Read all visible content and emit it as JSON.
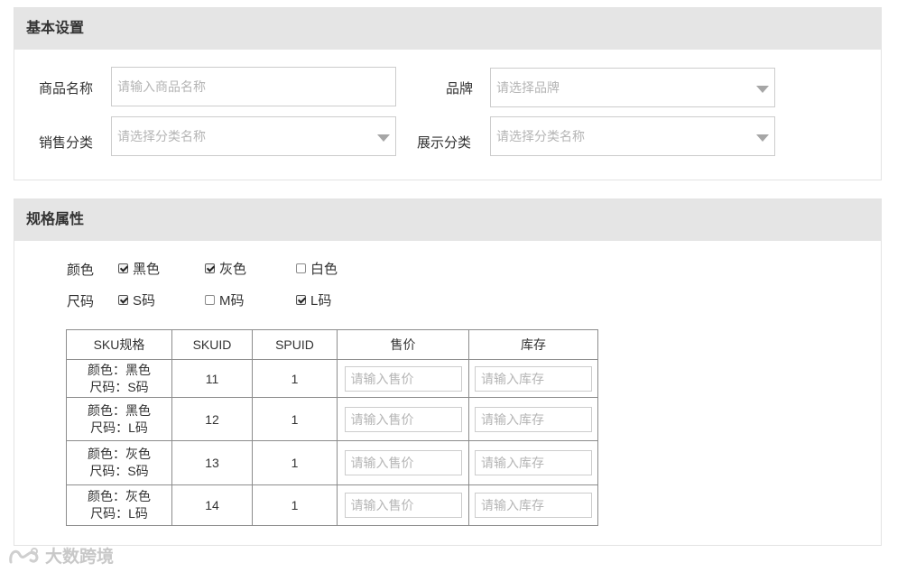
{
  "basic": {
    "title": "基本设置",
    "fields": {
      "product_name": {
        "label": "商品名称",
        "placeholder": "请输入商品名称"
      },
      "brand": {
        "label": "品牌",
        "placeholder": "请选择品牌"
      },
      "sales_category": {
        "label": "销售分类",
        "placeholder": "请选择分类名称"
      },
      "display_category": {
        "label": "展示分类",
        "placeholder": "请选择分类名称"
      }
    }
  },
  "spec": {
    "title": "规格属性",
    "color": {
      "label": "颜色",
      "options": [
        {
          "label": "黑色",
          "checked": true
        },
        {
          "label": "灰色",
          "checked": true
        },
        {
          "label": "白色",
          "checked": false
        }
      ]
    },
    "size": {
      "label": "尺码",
      "options": [
        {
          "label": "S码",
          "checked": true
        },
        {
          "label": "M码",
          "checked": false
        },
        {
          "label": "L码",
          "checked": true
        }
      ]
    },
    "table": {
      "headers": [
        "SKU规格",
        "SKUID",
        "SPUID",
        "售价",
        "库存"
      ],
      "price_placeholder": "请输入售价",
      "stock_placeholder": "请输入库存",
      "rows": [
        {
          "color": "颜色：黑色",
          "size": "尺码：S码",
          "skuid": "11",
          "spuid": "1"
        },
        {
          "color": "颜色：黑色",
          "size": "尺码：L码",
          "skuid": "12",
          "spuid": "1"
        },
        {
          "color": "颜色：灰色",
          "size": "尺码：S码",
          "skuid": "13",
          "spuid": "1"
        },
        {
          "color": "颜色：灰色",
          "size": "尺码：L码",
          "skuid": "14",
          "spuid": "1"
        }
      ]
    }
  },
  "watermark": {
    "text": "大数跨境",
    "icon": "infinity-logo-icon"
  }
}
